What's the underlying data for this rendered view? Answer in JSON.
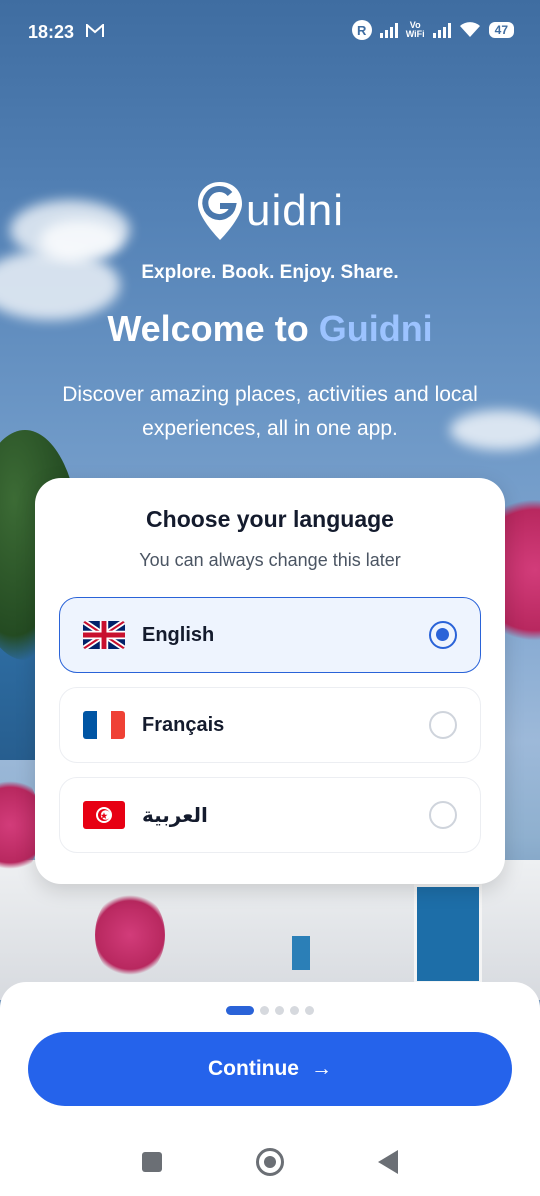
{
  "status_bar": {
    "time": "18:23",
    "vowifi_line1": "Vo",
    "vowifi_line2": "WiFi",
    "roaming": "R",
    "battery": "47"
  },
  "brand": {
    "logo_text": "uidni",
    "tagline": "Explore. Book. Enjoy. Share.",
    "welcome_prefix": "Welcome to ",
    "welcome_accent": "Guidni",
    "description": "Discover amazing places, activities and local experiences, all in one app."
  },
  "language_card": {
    "title": "Choose your language",
    "subtitle": "You can always change this later",
    "options": [
      {
        "label": "English",
        "flag": "uk-flag-icon",
        "selected": true
      },
      {
        "label": "Français",
        "flag": "france-flag-icon",
        "selected": false
      },
      {
        "label": "العربية",
        "flag": "tunisia-flag-icon",
        "selected": false
      }
    ]
  },
  "footer": {
    "continue_label": "Continue",
    "continue_arrow": "→",
    "pager_total": 5,
    "pager_active": 1
  },
  "colors": {
    "primary": "#2563eb",
    "accent_text": "#9cc3ff",
    "selected_bg": "#eef4fe"
  }
}
